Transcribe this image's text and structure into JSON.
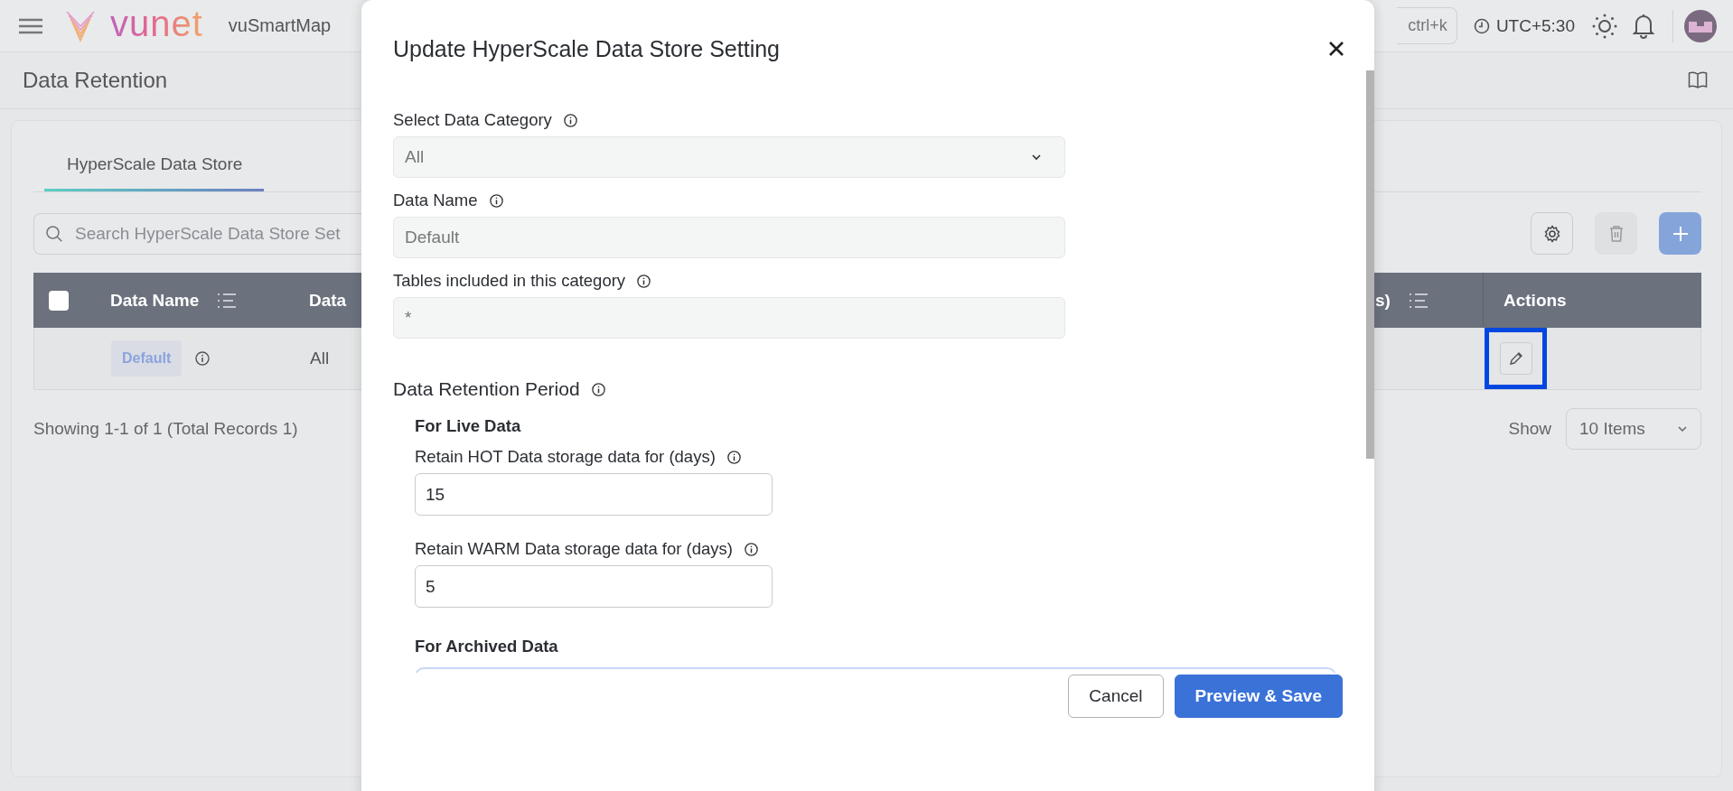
{
  "header": {
    "logo": "vunet",
    "product": "vuSmartMap",
    "search_hint": "ctrl+k",
    "timezone": "UTC+5:30"
  },
  "page": {
    "title": "Data Retention"
  },
  "tabs": [
    {
      "label": "HyperScale Data Store",
      "selected": true
    }
  ],
  "search": {
    "placeholder": "Search HyperScale Data Store Set"
  },
  "table": {
    "header_checkbox": {
      "checked": false
    },
    "columns": [
      {
        "label": "Data Name",
        "sortable": true
      },
      {
        "label": "Data",
        "sortable": false
      },
      {
        "label": "s)",
        "sortable": true
      },
      {
        "label": "Actions",
        "sortable": false
      }
    ],
    "rows": [
      {
        "name": "Default",
        "category": "All",
        "edit_focused": true
      }
    ]
  },
  "pagination": {
    "summary": "Showing 1-1 of 1 (Total Records 1)",
    "show_label": "Show",
    "page_size": "10 Items"
  },
  "dialog": {
    "title": "Update HyperScale Data Store Setting",
    "fields": [
      {
        "label": "Select Data Category",
        "kind": "select",
        "value": "All",
        "disabled": true
      },
      {
        "label": "Data Name",
        "kind": "text",
        "value": "Default",
        "disabled": true
      },
      {
        "label": "Tables included in this category",
        "kind": "text",
        "value": "*",
        "disabled": true
      }
    ],
    "retention": {
      "title": "Data Retention Period",
      "sections": [
        {
          "title": "For Live Data",
          "fields": [
            {
              "label": "Retain HOT Data storage data for (days)",
              "value": "15"
            },
            {
              "label": "Retain WARM Data storage data for (days)",
              "value": "5"
            }
          ]
        },
        {
          "title": "For Archived Data"
        }
      ]
    },
    "buttons": [
      {
        "label": "Cancel",
        "kind": "secondary"
      },
      {
        "label": "Preview & Save",
        "kind": "primary"
      }
    ]
  }
}
